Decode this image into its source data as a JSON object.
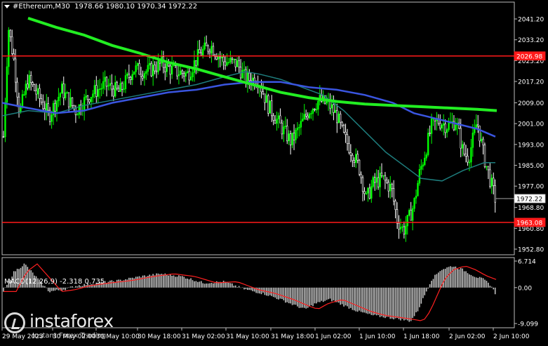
{
  "window": {
    "title": "#Ethereum,M30",
    "ohlc": "1978.66 1980.10 1970.34 1972.22"
  },
  "price_axis": {
    "ticks": [
      "2041.20",
      "2033.20",
      "2025.20",
      "2017.20",
      "2009.00",
      "2001.00",
      "1993.00",
      "1985.00",
      "1977.00",
      "1968.80",
      "1960.80",
      "1952.80"
    ],
    "levels": {
      "resistance": "2026.98",
      "current": "1972.22",
      "support": "1963.08"
    }
  },
  "time_axis": {
    "ticks": [
      "29 May 2023",
      "30 May 02:00",
      "30 May 10:00",
      "30 May 18:00",
      "31 May 02:00",
      "31 May 10:00",
      "31 May 18:00",
      "1 Jun 02:00",
      "1 Jun 10:00",
      "1 Jun 18:00",
      "2 Jun 02:00",
      "2 Jun 10:00"
    ]
  },
  "macd": {
    "label": "MACD(12,26,9) -2.318 0.735",
    "ticks": [
      "6.714",
      "0.00",
      "-9.099"
    ]
  },
  "watermark": {
    "brand": "instaforex",
    "tagline": "Instant Forex Trading"
  },
  "colors": {
    "background": "#000000",
    "bull_candle": "#00ff00",
    "bear_candle": "#ffffff",
    "ma_slow": "#22ee22",
    "ma_mid": "#3a55e0",
    "ma_fast": "#1e7d7d",
    "level_line": "#ff1a1a",
    "macd_hist": "#c0c0c0",
    "macd_signal": "#ff2020"
  }
}
